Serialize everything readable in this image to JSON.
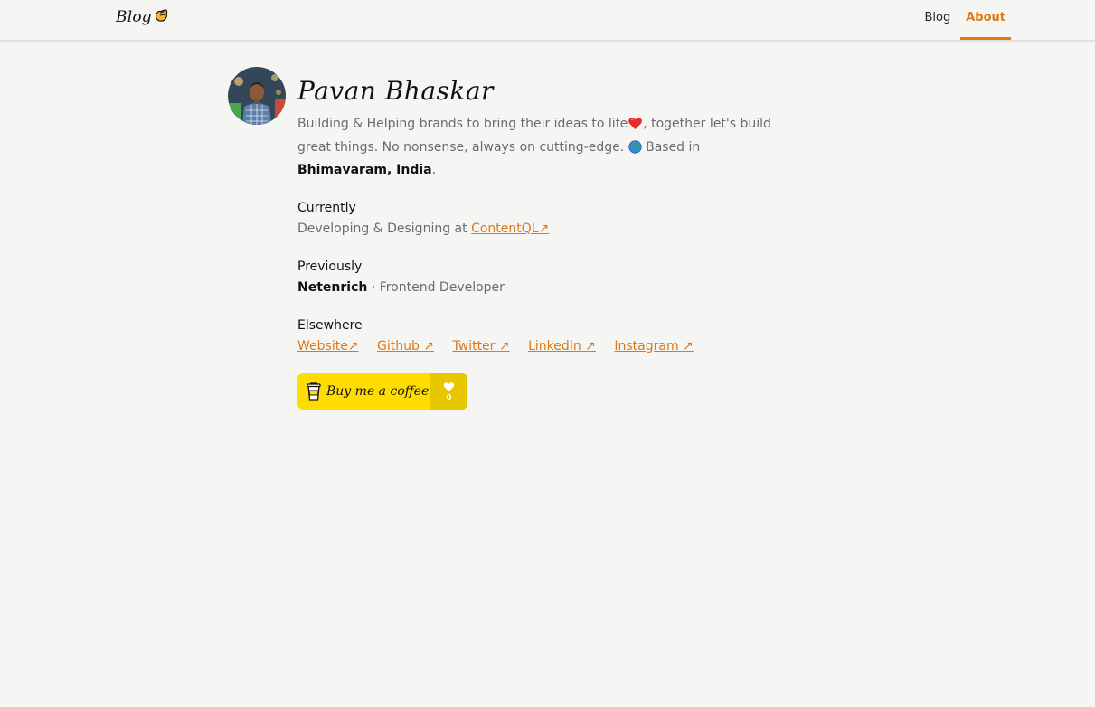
{
  "header": {
    "logo_text": "Blog",
    "nav": [
      {
        "label": "Blog",
        "active": false
      },
      {
        "label": "About",
        "active": true
      }
    ]
  },
  "profile": {
    "name": "Pavan Bhaskar",
    "bio_part1": "Building & Helping brands to bring their ideas to life",
    "bio_part2": ", together let's build great things. No nonsense, always on cutting-edge.",
    "bio_part3": " Based in ",
    "location": "Bhimavaram, India",
    "bio_end": "."
  },
  "currently": {
    "title": "Currently",
    "text": "Developing & Designing at ",
    "link": "ContentQL↗"
  },
  "previously": {
    "title": "Previously",
    "company": "Netenrich",
    "role": " · Frontend Developer"
  },
  "elsewhere": {
    "title": "Elsewhere",
    "links": [
      "Website↗",
      "Github ↗",
      "Twitter ↗",
      "LinkedIn ↗",
      "Instagram ↗"
    ]
  },
  "coffee": {
    "label": "Buy me a coffee",
    "count": "0"
  },
  "colors": {
    "accent": "#dd7a12",
    "background": "#f5f5f3",
    "coffee_yellow": "#ffdd00"
  },
  "icons": [
    "logo-hand-icon",
    "heart-emoji-icon",
    "globe-emoji-icon",
    "coffee-cup-icon",
    "heart-icon"
  ]
}
